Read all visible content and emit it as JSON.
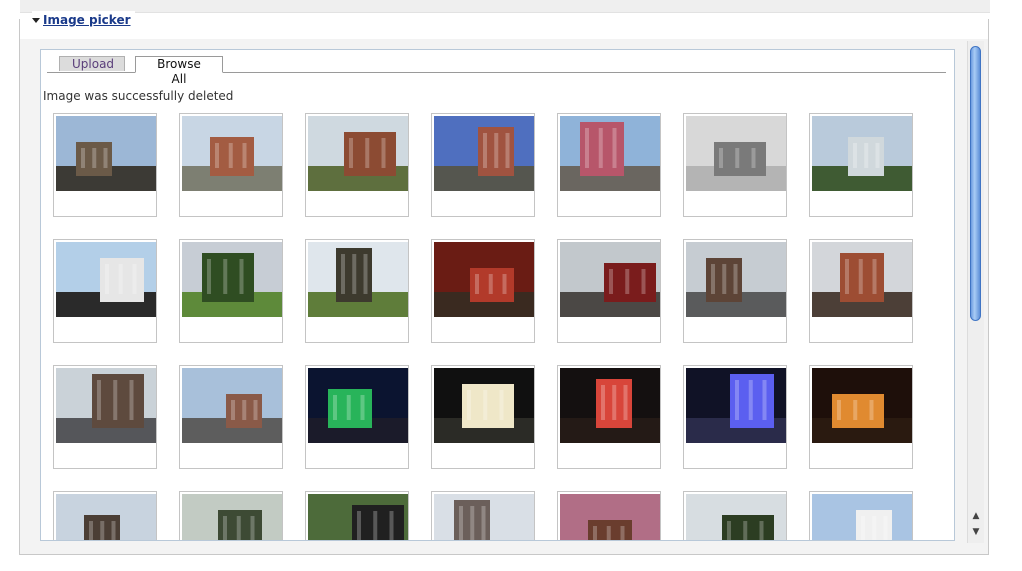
{
  "panel": {
    "title": "Image picker"
  },
  "tabs": [
    {
      "label": "Upload",
      "active": false
    },
    {
      "label": "Browse All",
      "active": true
    }
  ],
  "status_message": "Image was successfully deleted",
  "thumbnails": [
    {
      "icon": "building-render-1",
      "sky": "#9cb7d6",
      "ground": "#3c3a35",
      "subject": "#6b5a48"
    },
    {
      "icon": "apartment-brick",
      "sky": "#c8d6e4",
      "ground": "#7d7f72",
      "subject": "#a35c42"
    },
    {
      "icon": "modern-condo",
      "sky": "#cfd9e0",
      "ground": "#5e6f3e",
      "subject": "#8c4b33"
    },
    {
      "icon": "tower-dusk",
      "sky": "#4f6fbf",
      "ground": "#55564f",
      "subject": "#a05340"
    },
    {
      "icon": "tower-render-2",
      "sky": "#8fb3d9",
      "ground": "#6a6660",
      "subject": "#b7566a"
    },
    {
      "icon": "site-plan",
      "sky": "#d8d8d8",
      "ground": "#b4b4b4",
      "subject": "#7a7a7a"
    },
    {
      "icon": "highrise-trees",
      "sky": "#b9cadb",
      "ground": "#3f5b33",
      "subject": "#d0d8dc"
    },
    {
      "icon": "highrise-render",
      "sky": "#b3cfe8",
      "ground": "#2a2a2a",
      "subject": "#e6e6e6"
    },
    {
      "icon": "park-lawn",
      "sky": "#c7cdd5",
      "ground": "#5e8a3a",
      "subject": "#2f4d22"
    },
    {
      "icon": "tree-street",
      "sky": "#dfe6ec",
      "ground": "#5f7d3a",
      "subject": "#3d3a2e"
    },
    {
      "icon": "restaurant-interior",
      "sky": "#6a1c14",
      "ground": "#3a2a20",
      "subject": "#b23a2a"
    },
    {
      "icon": "restaurant-sign",
      "sky": "#c2c8cc",
      "ground": "#4b4845",
      "subject": "#7a1c1c"
    },
    {
      "icon": "street-cars",
      "sky": "#c6ccd2",
      "ground": "#5a5b5c",
      "subject": "#5d4437"
    },
    {
      "icon": "brick-storefront",
      "sky": "#d3d6da",
      "ground": "#4c3f37",
      "subject": "#9d4d33"
    },
    {
      "icon": "street-view",
      "sky": "#cad2d8",
      "ground": "#55565a",
      "subject": "#5e4a3e"
    },
    {
      "icon": "mixed-use-building",
      "sky": "#a8c0da",
      "ground": "#5d5d5d",
      "subject": "#8a5a48"
    },
    {
      "icon": "night-tower-green",
      "sky": "#0b1430",
      "ground": "#1b1b2a",
      "subject": "#28b45a"
    },
    {
      "icon": "holiday-lights",
      "sky": "#101010",
      "ground": "#2b2b26",
      "subject": "#efe7c8"
    },
    {
      "icon": "neon-night",
      "sky": "#141010",
      "ground": "#241a16",
      "subject": "#d8453a"
    },
    {
      "icon": "night-blue-stage",
      "sky": "#101226",
      "ground": "#2a2b4a",
      "subject": "#5b5ff0"
    },
    {
      "icon": "night-traffic",
      "sky": "#1e0f0a",
      "ground": "#2a1a10",
      "subject": "#e08a30"
    },
    {
      "icon": "victorian-house",
      "sky": "#c8d3df",
      "ground": "#6d6a5c",
      "subject": "#4b3e35"
    },
    {
      "icon": "cemetery",
      "sky": "#c2cbc3",
      "ground": "#e7e7e7",
      "subject": "#3d4a34"
    },
    {
      "icon": "historic-sign",
      "sky": "#4d6b3a",
      "ground": "#2c3a22",
      "subject": "#202020"
    },
    {
      "icon": "old-house-trees",
      "sky": "#d9dfe6",
      "ground": "#4f6a3a",
      "subject": "#6b5f5a"
    },
    {
      "icon": "dusk-house",
      "sky": "#b16e86",
      "ground": "#3b2e2a",
      "subject": "#6a3d2e"
    },
    {
      "icon": "tree-lined-street",
      "sky": "#d7dde1",
      "ground": "#36502a",
      "subject": "#2c3d22"
    },
    {
      "icon": "white-house-porch",
      "sky": "#a9c4e3",
      "ground": "#9a9aa0",
      "subject": "#f0f0f0"
    }
  ],
  "scrollbar": {
    "up_arrow": "▲",
    "down_arrow": "▼"
  },
  "colors": {
    "link": "#1a3a8a",
    "panel_border": "#b8c8d8",
    "scroll_thumb": "#6d9ce0"
  }
}
